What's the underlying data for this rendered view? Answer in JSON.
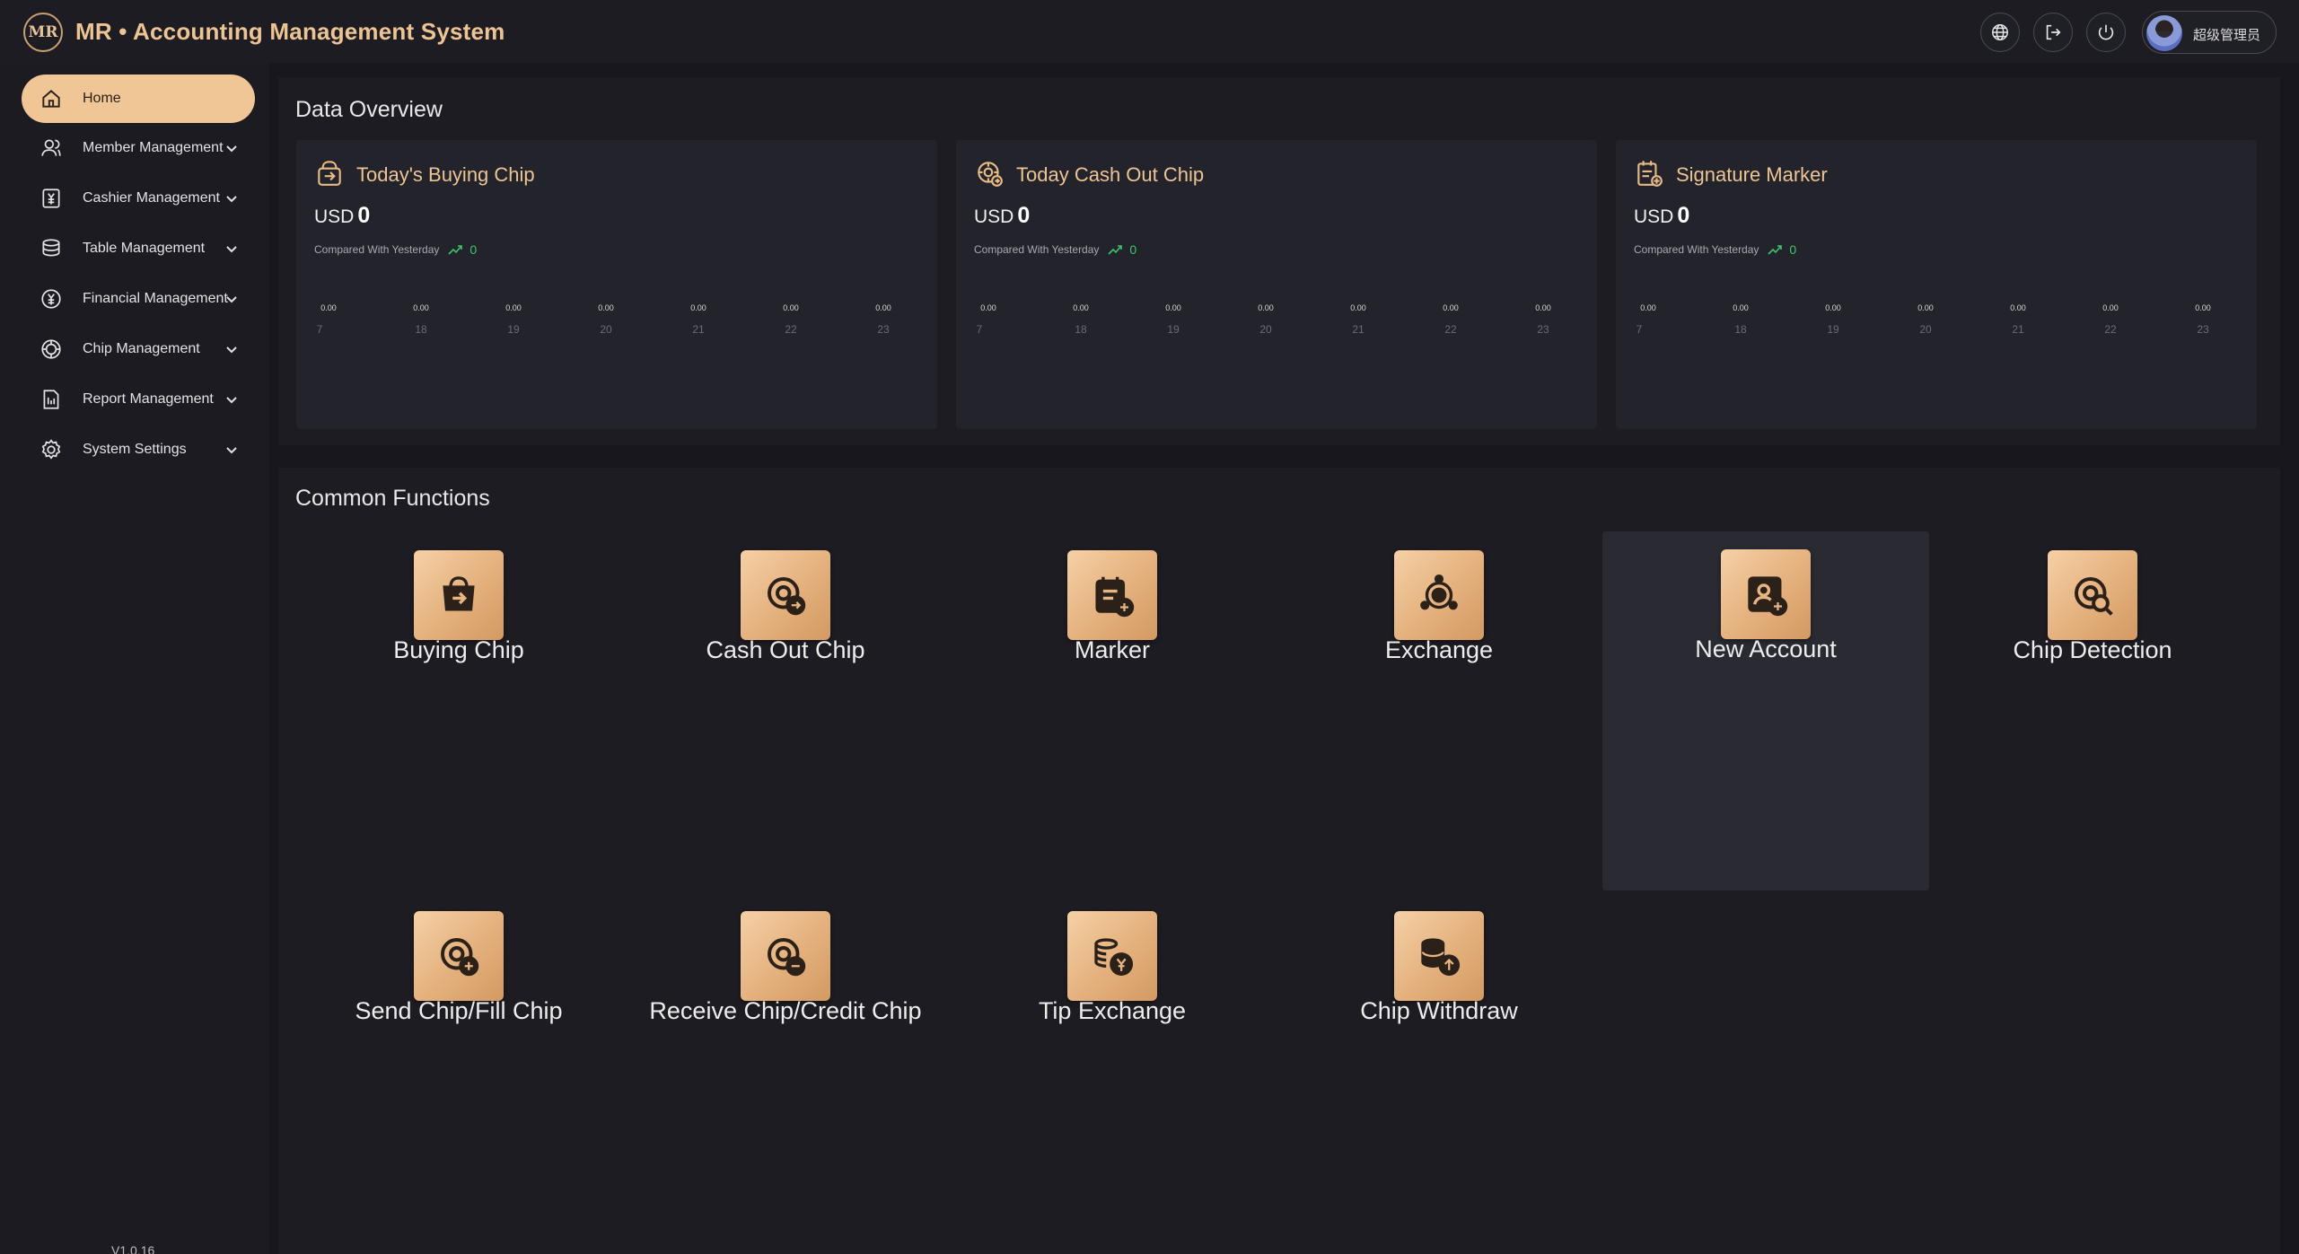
{
  "header": {
    "logo_text": "MR",
    "title": "MR • Accounting Management System",
    "user_name": "超级管理员",
    "buttons": [
      "globe-icon",
      "logout-icon",
      "power-icon"
    ]
  },
  "sidebar": {
    "items": [
      {
        "label": "Home",
        "icon": "home-icon",
        "active": true
      },
      {
        "label": "Member Management",
        "icon": "member-icon"
      },
      {
        "label": "Cashier Management",
        "icon": "cashier-icon"
      },
      {
        "label": "Table Management",
        "icon": "table-icon"
      },
      {
        "label": "Financial Management",
        "icon": "financial-icon"
      },
      {
        "label": "Chip Management",
        "icon": "chip-icon"
      },
      {
        "label": "Report Management",
        "icon": "report-icon"
      },
      {
        "label": "System Settings",
        "icon": "settings-icon"
      }
    ],
    "version": "V1.0.16"
  },
  "overview": {
    "title": "Data Overview",
    "cards": [
      {
        "title": "Today's Buying Chip",
        "currency": "USD",
        "amount": "0",
        "compare_label": "Compared With Yesterday",
        "delta": "0",
        "icon": "buying-chip-icon"
      },
      {
        "title": "Today Cash Out Chip",
        "currency": "USD",
        "amount": "0",
        "compare_label": "Compared With Yesterday",
        "delta": "0",
        "icon": "cash-out-icon"
      },
      {
        "title": "Signature Marker",
        "currency": "USD",
        "amount": "0",
        "compare_label": "Compared With Yesterday",
        "delta": "0",
        "icon": "marker-icon"
      }
    ]
  },
  "chart_data": [
    {
      "type": "line",
      "x": [
        "7",
        "18",
        "19",
        "20",
        "21",
        "22",
        "23"
      ],
      "series": [
        {
          "values": [
            0,
            0,
            0,
            0,
            0,
            0,
            0
          ],
          "labels": [
            "0.00",
            "0.00",
            "0.00",
            "0.00",
            "0.00",
            "0.00",
            "0.00"
          ]
        }
      ]
    },
    {
      "type": "line",
      "x": [
        "7",
        "18",
        "19",
        "20",
        "21",
        "22",
        "23"
      ],
      "series": [
        {
          "values": [
            0,
            0,
            0,
            0,
            0,
            0,
            0
          ],
          "labels": [
            "0.00",
            "0.00",
            "0.00",
            "0.00",
            "0.00",
            "0.00",
            "0.00"
          ]
        }
      ]
    },
    {
      "type": "line",
      "x": [
        "7",
        "18",
        "19",
        "20",
        "21",
        "22",
        "23"
      ],
      "series": [
        {
          "values": [
            0,
            0,
            0,
            0,
            0,
            0,
            0
          ],
          "labels": [
            "0.00",
            "0.00",
            "0.00",
            "0.00",
            "0.00",
            "0.00",
            "0.00"
          ]
        }
      ]
    }
  ],
  "functions": {
    "title": "Common Functions",
    "items": [
      {
        "label": "Buying Chip",
        "icon": "buying-chip-icon"
      },
      {
        "label": "Cash Out Chip",
        "icon": "cash-out-chip-icon"
      },
      {
        "label": "Marker",
        "icon": "marker-icon"
      },
      {
        "label": "Exchange",
        "icon": "exchange-icon"
      },
      {
        "label": "New Account",
        "icon": "new-account-icon"
      },
      {
        "label": "Chip Detection",
        "icon": "chip-detection-icon"
      },
      {
        "label": "Send Chip/Fill Chip",
        "icon": "send-chip-icon"
      },
      {
        "label": "Receive Chip/Credit Chip",
        "icon": "receive-chip-icon"
      },
      {
        "label": "Tip Exchange",
        "icon": "tip-exchange-icon"
      },
      {
        "label": "Chip Withdraw",
        "icon": "chip-withdraw-icon"
      }
    ]
  },
  "colors": {
    "accent": "#f1c697",
    "accent_text": "#edc494",
    "background": "#17171d",
    "panel": "#1c1c22",
    "card": "#23232c",
    "positive": "#3ec46d"
  }
}
